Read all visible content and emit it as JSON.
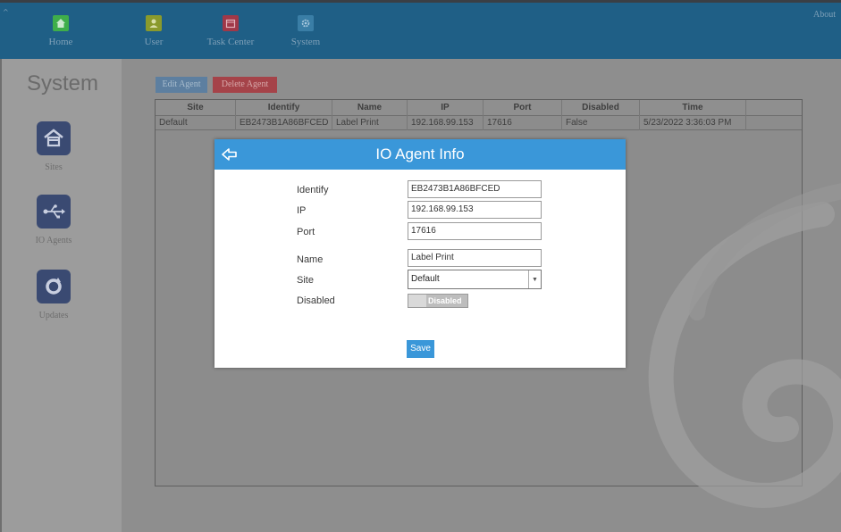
{
  "topbar": {
    "apps": [
      {
        "label": "Home",
        "icon": "home-icon",
        "color": "#3fae4a"
      },
      {
        "label": "User",
        "icon": "user-icon",
        "color": "#8a9a2c"
      },
      {
        "label": "Task Center",
        "icon": "calendar-icon",
        "color": "#a03848"
      },
      {
        "label": "System",
        "icon": "gear-icon",
        "color": "#3a7ea6"
      }
    ],
    "about_label": "About"
  },
  "sidebar": {
    "title": "System",
    "items": [
      {
        "label": "Sites",
        "icon": "house-icon"
      },
      {
        "label": "IO Agents",
        "icon": "usb-icon"
      },
      {
        "label": "Updates",
        "icon": "refresh-icon"
      }
    ]
  },
  "toolbar": {
    "edit_label": "Edit Agent",
    "delete_label": "Delete Agent"
  },
  "grid": {
    "columns": [
      "Site",
      "Identify",
      "Name",
      "IP",
      "Port",
      "Disabled",
      "Time"
    ],
    "rows": [
      [
        "Default",
        "EB2473B1A86BFCED",
        "Label Print",
        "192.168.99.153",
        "17616",
        "False",
        "5/23/2022 3:36:03 PM"
      ]
    ]
  },
  "modal": {
    "title": "IO Agent Info",
    "fields": {
      "identify_label": "Identify",
      "identify_value": "EB2473B1A86BFCED",
      "ip_label": "IP",
      "ip_value": "192.168.99.153",
      "port_label": "Port",
      "port_value": "17616",
      "name_label": "Name",
      "name_value": "Label Print",
      "site_label": "Site",
      "site_value": "Default",
      "disabled_label": "Disabled",
      "disabled_toggle_text": "Disabled"
    },
    "save_label": "Save",
    "accent": "#3a97d9"
  }
}
